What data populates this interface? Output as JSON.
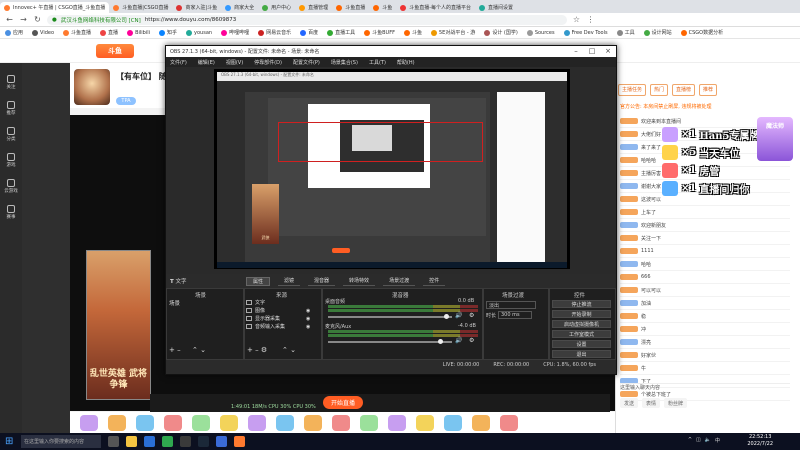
{
  "browser": {
    "tabs": [
      "Innovec+ 午直播 | CSGO直播_斗鱼直播",
      "斗鱼直播|CSGO直播",
      "商家入驻|斗鱼",
      "商家大全",
      "用户中心",
      "直播管理",
      "斗鱼直播",
      "斗鱼",
      "斗鱼直播-每个人的直播平台",
      "直播间设置"
    ],
    "url_secure": "武汉斗鱼网络科技有限公司 [CN]",
    "url": "https://www.douyu.com/8609873",
    "bookmarks": [
      "应用",
      "Video",
      "斗鱼直播",
      "直播",
      "Bilibili",
      "知乎",
      "yousan",
      "哔哩哔哩",
      "网易云音乐",
      "百度",
      "直播工具",
      "斗鱼BUFF",
      "斗鱼",
      "5E对战平台 - 游",
      "设计 (国学)",
      "Sources",
      "Free Dev Tools",
      "工具",
      "设计网站",
      "CSGO数据分析"
    ]
  },
  "page": {
    "logo": "斗鱼",
    "room_title": "【有车位】 随便",
    "room_tag": "TPA",
    "left_nav": [
      "关注",
      "推荐",
      "分类",
      "游戏",
      "云游戏",
      "赛事"
    ],
    "promo_text": "乱世英雄 武将争锋",
    "live_button": "开始直播",
    "live_stats": "1:49:01 18M/s  CPU 30%  CPU 30%"
  },
  "sidebar": {
    "tabs": [
      "主播任务",
      "热门",
      "直播榜",
      "推荐"
    ],
    "notice": "官方公告: 本房间禁止刷屏, 违规将被处理",
    "overlay": [
      {
        "mult": "×1",
        "text": "Han5专属牌牌",
        "color": "#c9a0ff"
      },
      {
        "mult": "×5",
        "text": "当天车位",
        "color": "#ffd34a"
      },
      {
        "mult": "×1",
        "text": "房管",
        "color": "#ff6b6b"
      },
      {
        "mult": "×1",
        "text": "直播间归你",
        "color": "#5ab0ff"
      }
    ],
    "badge": "魔法师",
    "feed": [
      "欢迎来到本直播间",
      "大佬们好",
      "来了来了",
      "哈哈哈",
      "主播厉害",
      "谢谢大家",
      "这波可以",
      "上车了",
      "欢迎新朋友",
      "关注一下",
      "1111",
      "哈哈",
      "666",
      "可以可以",
      "加油",
      "稳",
      "冲",
      "漂亮",
      "好家伙",
      "牛",
      "下了",
      "个被总下班了"
    ],
    "chat_placeholder": "这里输入聊天内容",
    "foot_buttons": [
      "发送",
      "表情",
      "粉丝牌"
    ]
  },
  "obs": {
    "title": "OBS 27.1.3 (64-bit, windows) - 配置文件: 未命名 - 场景: 未命名",
    "menu": [
      "文件(F)",
      "编辑(E)",
      "视图(V)",
      "停靠部件(D)",
      "配置文件(P)",
      "场景集合(S)",
      "工具(T)",
      "帮助(H)"
    ],
    "source_tab": "文字",
    "dock_tabs": [
      "属性",
      "滤镜",
      "混音器",
      "转场特效",
      "场景过渡",
      "控件"
    ],
    "panels": {
      "scenes": "场景",
      "sources": "来源",
      "mixer": "混音器",
      "transitions": "场景过渡",
      "controls": "控件"
    },
    "scene_item": "场景",
    "sources": [
      "文字",
      "图像",
      "显示器采集",
      "音频输入采集"
    ],
    "mixer": [
      {
        "name": "桌面音频",
        "db": "0.0 dB"
      },
      {
        "name": "麦克风/Aux",
        "db": "-4.0 dB"
      }
    ],
    "transition": {
      "type": "淡出",
      "duration_label": "时长",
      "duration": "300 ms"
    },
    "controls": [
      "停止推流",
      "开始录制",
      "启动虚拟摄像机",
      "工作室模式",
      "设置",
      "退出"
    ],
    "status": [
      "LIVE: 00:00:00",
      "REC: 00:00:00",
      "CPU: 1.8%, 60.00 fps"
    ]
  },
  "nested": {
    "bar_text": "OBS 27.1.3 (64-bit, windows) - 配置文件: 未命名",
    "promo": "武侠"
  },
  "taskbar": {
    "search": "在这里输入你要搜索的内容",
    "time": "22:52:13",
    "date": "2022/7/22",
    "tray": "中"
  }
}
